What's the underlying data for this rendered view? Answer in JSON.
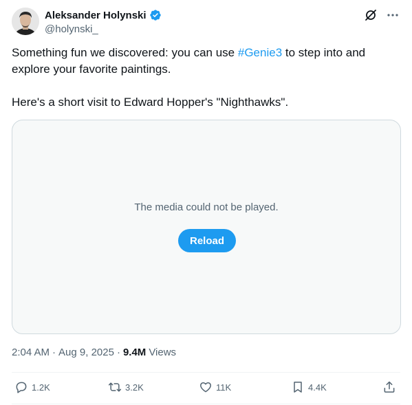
{
  "author": {
    "display_name": "Aleksander Holynski",
    "handle": "@holynski_",
    "verified": true,
    "verified_color": "#1d9bf0"
  },
  "top_icons": [
    "grok-icon",
    "more-icon"
  ],
  "text": {
    "line1_before": "Something fun we discovered: you can use ",
    "hashtag": "#Genie3",
    "line1_after": " to step into and explore your favorite paintings.",
    "line2": "Here's a short visit to Edward Hopper's \"Nighthawks\"."
  },
  "media": {
    "message": "The media could not be played.",
    "reload_label": "Reload"
  },
  "meta": {
    "time": "2:04 AM",
    "sep1": "·",
    "date": "Aug 9, 2025",
    "sep2": "·",
    "views_count": "9.4M",
    "views_label": "Views"
  },
  "actions": {
    "replies": "1.2K",
    "reposts": "3.2K",
    "likes": "11K",
    "bookmarks": "4.4K"
  },
  "colors": {
    "accent": "#1d9bf0",
    "text_primary": "#0f1419",
    "text_secondary": "#536471",
    "border": "#cfd9de"
  }
}
